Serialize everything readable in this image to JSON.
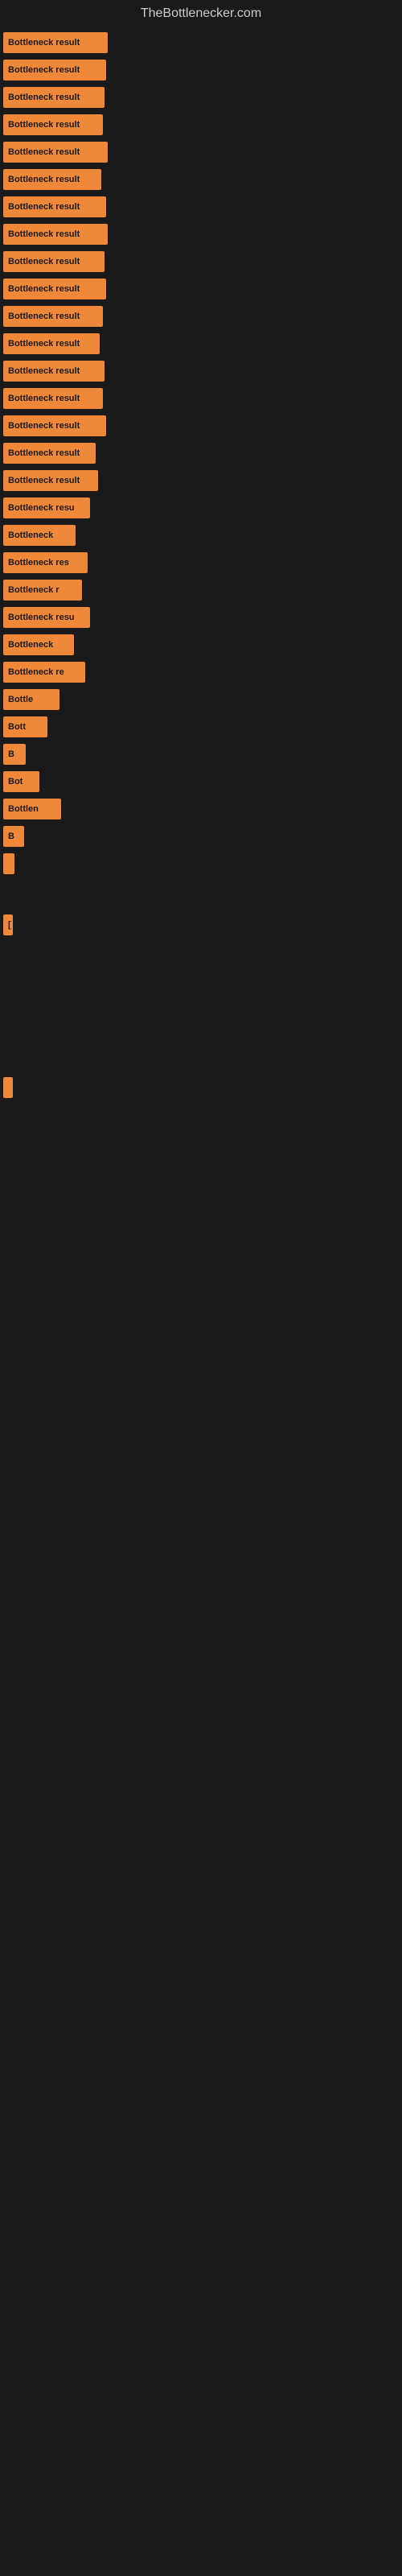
{
  "site": {
    "title": "TheBottlenecker.com"
  },
  "bars": [
    {
      "label": "Bottleneck result",
      "width": 130
    },
    {
      "label": "Bottleneck result",
      "width": 128
    },
    {
      "label": "Bottleneck result",
      "width": 126
    },
    {
      "label": "Bottleneck result",
      "width": 124
    },
    {
      "label": "Bottleneck result",
      "width": 130
    },
    {
      "label": "Bottleneck result",
      "width": 122
    },
    {
      "label": "Bottleneck result",
      "width": 128
    },
    {
      "label": "Bottleneck result",
      "width": 130
    },
    {
      "label": "Bottleneck result",
      "width": 126
    },
    {
      "label": "Bottleneck result",
      "width": 128
    },
    {
      "label": "Bottleneck result",
      "width": 124
    },
    {
      "label": "Bottleneck result",
      "width": 120
    },
    {
      "label": "Bottleneck result",
      "width": 126
    },
    {
      "label": "Bottleneck result",
      "width": 124
    },
    {
      "label": "Bottleneck result",
      "width": 128
    },
    {
      "label": "Bottleneck result",
      "width": 115
    },
    {
      "label": "Bottleneck result",
      "width": 118
    },
    {
      "label": "Bottleneck resu",
      "width": 108
    },
    {
      "label": "Bottleneck",
      "width": 90
    },
    {
      "label": "Bottleneck res",
      "width": 105
    },
    {
      "label": "Bottleneck r",
      "width": 98
    },
    {
      "label": "Bottleneck resu",
      "width": 108
    },
    {
      "label": "Bottleneck",
      "width": 88
    },
    {
      "label": "Bottleneck re",
      "width": 102
    },
    {
      "label": "Bottle",
      "width": 70
    },
    {
      "label": "Bott",
      "width": 55
    },
    {
      "label": "B",
      "width": 28
    },
    {
      "label": "Bot",
      "width": 45
    },
    {
      "label": "Bottlen",
      "width": 72
    },
    {
      "label": "B",
      "width": 26
    },
    {
      "label": "",
      "width": 14
    },
    {
      "label": "",
      "width": 0
    },
    {
      "label": "[",
      "width": 12
    },
    {
      "label": "",
      "width": 0
    },
    {
      "label": "",
      "width": 0
    },
    {
      "label": "",
      "width": 0
    },
    {
      "label": "",
      "width": 0
    },
    {
      "label": "",
      "width": 5
    }
  ]
}
